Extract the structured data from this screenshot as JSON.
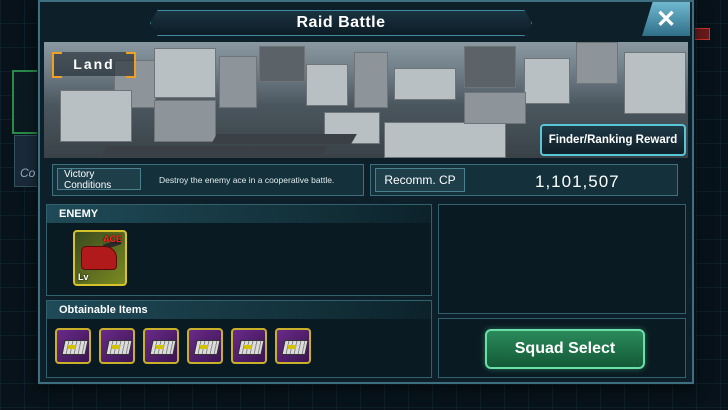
{
  "dialog": {
    "title": "Raid Battle",
    "close_label": "✕"
  },
  "banner": {
    "terrain_label": "Land",
    "finder_ranking_label": "Finder/Ranking Reward"
  },
  "victory": {
    "label": "Victory Conditions",
    "text": "Destroy the enemy ace in a cooperative battle."
  },
  "recommended_cp": {
    "label": "Recomm. CP",
    "value": "1,101,507"
  },
  "enemy_panel": {
    "header": "ENEMY",
    "enemy": {
      "badge": "ACE",
      "level_mark": "Lv"
    }
  },
  "items_panel": {
    "header": "Obtainable Items",
    "items": [
      {
        "icon": "chip-part-icon"
      },
      {
        "icon": "chip-part-icon"
      },
      {
        "icon": "chip-part-icon"
      },
      {
        "icon": "chip-part-icon"
      },
      {
        "icon": "chip-part-icon"
      },
      {
        "icon": "chip-part-icon"
      }
    ]
  },
  "squad_select_label": "Squad Select",
  "colors": {
    "accent_cyan": "#57c7d8",
    "frame": "#3d6f80",
    "terrain_bracket": "#f0a020",
    "squad_green": "#2a8a5a",
    "item_border_gold": "#c9b02a",
    "ace_red": "#ff2020"
  }
}
